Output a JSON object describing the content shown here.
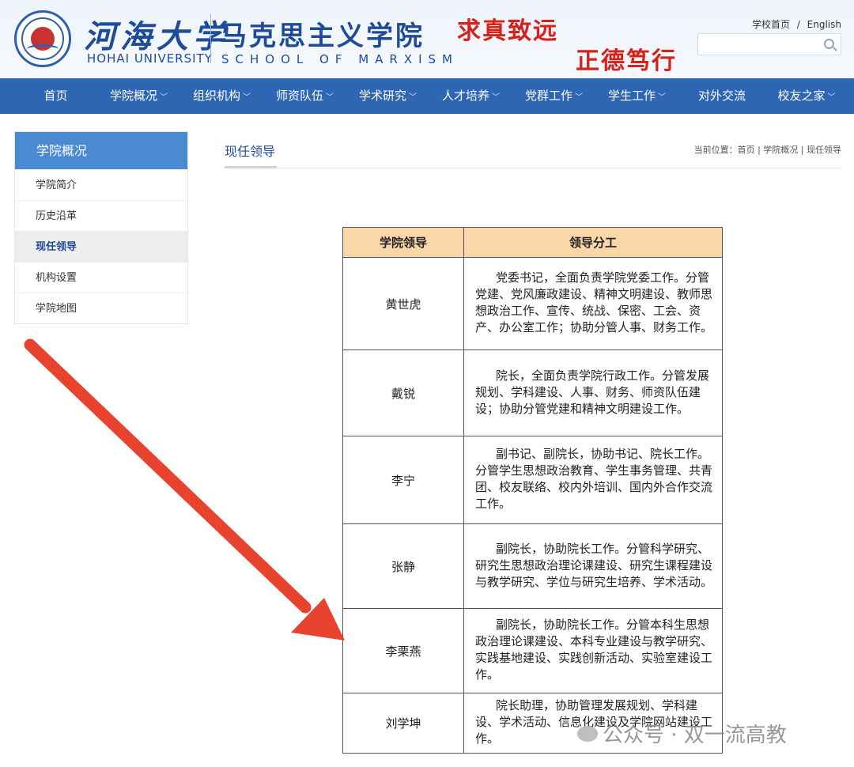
{
  "header": {
    "university_cn": "河海大学",
    "university_en": "HOHAI UNIVERSITY",
    "school_cn": "马克思主义学院",
    "school_en": "SCHOOL OF MARXISM",
    "motto_1": "求真致远",
    "motto_2": "正德笃行",
    "link_home": "学校首页",
    "link_sep": "/",
    "link_english": "English",
    "search_placeholder": "",
    "search_icon": "search-icon"
  },
  "nav": {
    "items": [
      {
        "label": "首页",
        "chevron": false
      },
      {
        "label": "学院概况",
        "chevron": true
      },
      {
        "label": "组织机构",
        "chevron": true
      },
      {
        "label": "师资队伍",
        "chevron": true
      },
      {
        "label": "学术研究",
        "chevron": true
      },
      {
        "label": "人才培养",
        "chevron": true
      },
      {
        "label": "党群工作",
        "chevron": true
      },
      {
        "label": "学生工作",
        "chevron": true
      },
      {
        "label": "对外交流",
        "chevron": false
      },
      {
        "label": "校友之家",
        "chevron": true
      }
    ],
    "chevron_glyph": "﹀"
  },
  "sidebar": {
    "title": "学院概况",
    "items": [
      {
        "label": "学院简介",
        "active": false
      },
      {
        "label": "历史沿革",
        "active": false
      },
      {
        "label": "现任领导",
        "active": true
      },
      {
        "label": "机构设置",
        "active": false
      },
      {
        "label": "学院地图",
        "active": false
      }
    ]
  },
  "main": {
    "title": "现任领导",
    "breadcrumb": {
      "prefix": "当前位置：",
      "home": "首页",
      "sep": " | ",
      "level1": "学院概况",
      "level2": "现任领导"
    }
  },
  "table": {
    "headers": [
      "学院领导",
      "领导分工"
    ],
    "rows": [
      {
        "name": "黄世虎",
        "duty": "党委书记，全面负责学院党委工作。分管党建、党风廉政建设、精神文明建设、教师思想政治工作、宣传、统战、保密、工会、资产、办公室工作；协助分管人事、财务工作。"
      },
      {
        "name": "戴锐",
        "duty": "院长，全面负责学院行政工作。分管发展规划、学科建设、人事、财务、师资队伍建设；协助分管党建和精神文明建设工作。"
      },
      {
        "name": "李宁",
        "duty": "副书记、副院长，协助书记、院长工作。分管学生思想政治教育、学生事务管理、共青团、校友联络、校内外培训、国内外合作交流工作。"
      },
      {
        "name": "张静",
        "duty": "副院长，协助院长工作。分管科学研究、研究生思想政治理论课建设、研究生课程建设与教学研究、学位与研究生培养、学术活动。"
      },
      {
        "name": "李栗燕",
        "duty": "副院长，协助院长工作。分管本科生思想政治理论课建设、本科专业建设与教学研究、实践基地建设、实践创新活动、实验室建设工作。"
      },
      {
        "name": "刘学坤",
        "duty": "院长助理，协助管理发展规划、学科建设、学术活动、信息化建设及学院网站建设工作。"
      }
    ]
  },
  "annotation": {
    "arrow_color": "#e8432f"
  },
  "watermark": {
    "text": "公众号 · 双一流高教"
  }
}
